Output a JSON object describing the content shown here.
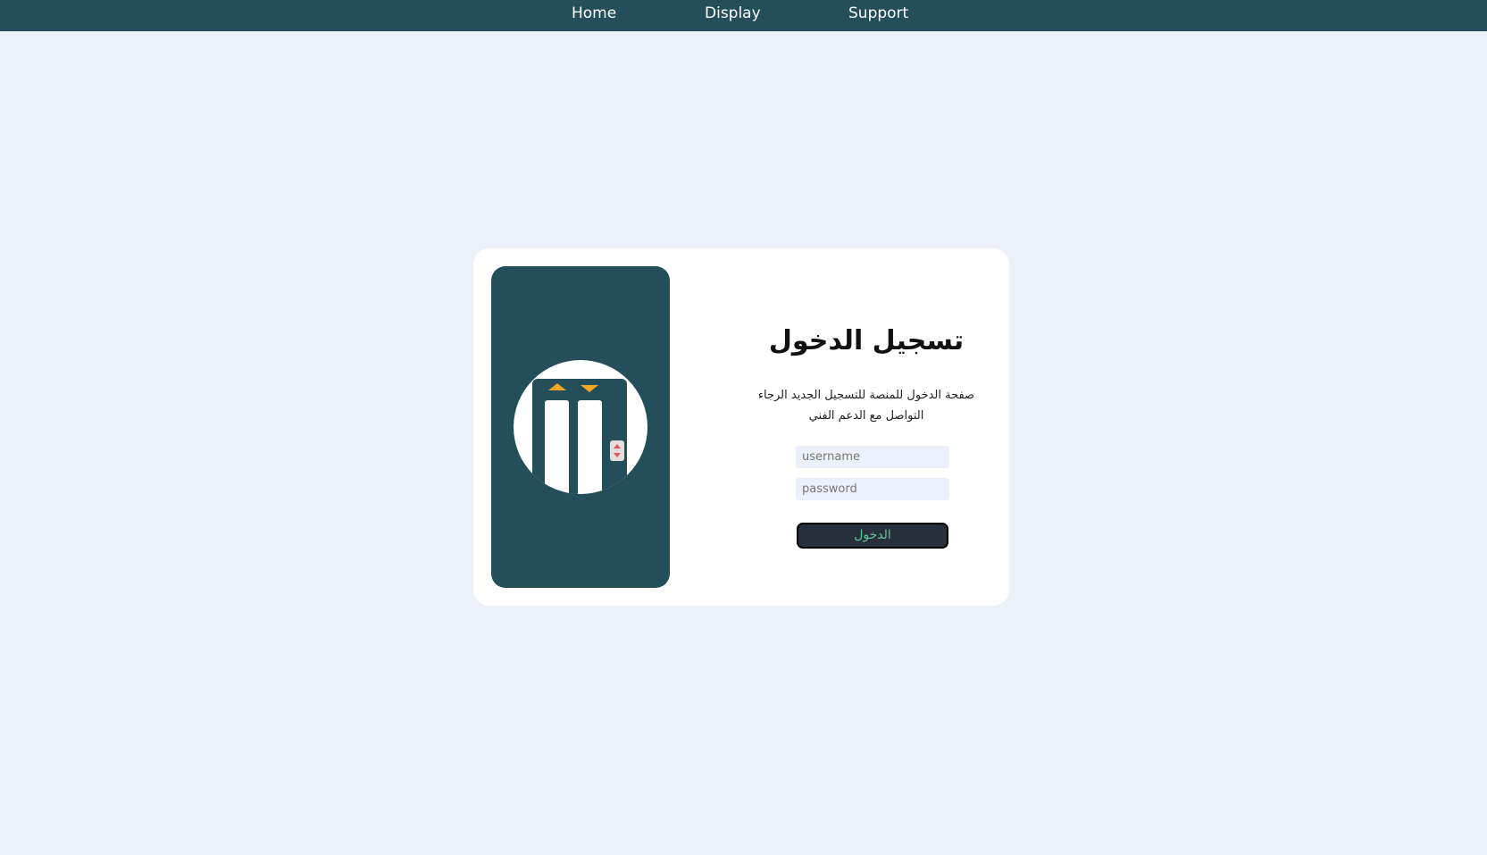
{
  "nav": {
    "items": [
      {
        "label": "Home"
      },
      {
        "label": "Display"
      },
      {
        "label": "Support"
      }
    ]
  },
  "login": {
    "title": "تسجيل الدخول",
    "description": "صفحة الدخول للمنصة للتسجيل الجديد الرجاء التواصل مع الدعم الفني",
    "username_placeholder": "username",
    "password_placeholder": "password",
    "submit_label": "الدخول"
  },
  "logo": {
    "icon": "elevator-icon"
  },
  "colors": {
    "nav_bg": "#234e5a",
    "page_bg": "#ecf0f8",
    "panel_bg": "#234e5a",
    "button_bg": "#272f3a",
    "button_text": "#5ec992",
    "arrow": "#f5a623"
  }
}
